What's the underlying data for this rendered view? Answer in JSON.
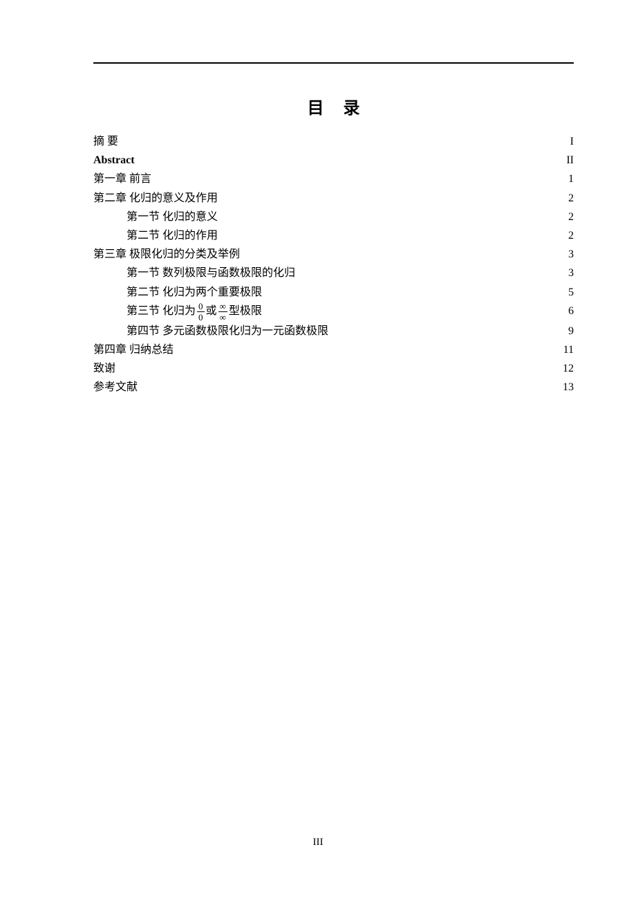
{
  "title": "目录",
  "footer_page": "III",
  "entries": [
    {
      "label": "摘 要",
      "page": "I",
      "indent": false,
      "bold": false
    },
    {
      "label": "Abstract",
      "page": "II",
      "indent": false,
      "bold": true
    },
    {
      "label": "第一章  前言",
      "page": "1",
      "indent": false,
      "bold": false
    },
    {
      "label": "第二章  化归的意义及作用",
      "page": "2",
      "indent": false,
      "bold": false
    },
    {
      "label": "第一节  化归的意义",
      "page": "2",
      "indent": true,
      "bold": false
    },
    {
      "label": "第二节  化归的作用",
      "page": "2",
      "indent": true,
      "bold": false
    },
    {
      "label": "第三章  极限化归的分类及举例",
      "page": "3",
      "indent": false,
      "bold": false
    },
    {
      "label": "第一节  数列极限与函数极限的化归",
      "page": "3",
      "indent": true,
      "bold": false
    },
    {
      "label": "第二节  化归为两个重要极限",
      "page": "5",
      "indent": true,
      "bold": false
    },
    {
      "label_pre": "第三节  化归为",
      "frac1": {
        "num": "0",
        "den": "0"
      },
      "mid": "或",
      "frac2": {
        "num": "∞",
        "den": "∞"
      },
      "label_post": "型极限",
      "page": "6",
      "indent": true,
      "special": "fracs"
    },
    {
      "label": "第四节  多元函数极限化归为一元函数极限",
      "page": "9",
      "indent": true,
      "bold": false
    },
    {
      "label": "第四章  归纳总结",
      "page": "11",
      "indent": false,
      "bold": false
    },
    {
      "label": "致谢",
      "page": "12",
      "indent": false,
      "bold": false
    },
    {
      "label": "参考文献",
      "page": "13",
      "indent": false,
      "bold": false
    }
  ]
}
